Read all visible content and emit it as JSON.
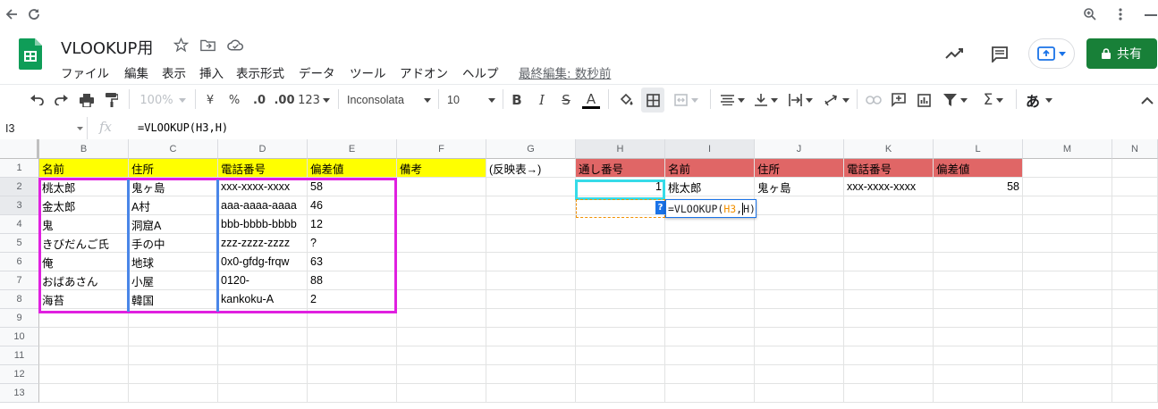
{
  "doc": {
    "title": "VLOOKUP用",
    "last_edit": "最終編集: 数秒前",
    "share_label": "共有"
  },
  "menu": [
    "ファイル",
    "編集",
    "表示",
    "挿入",
    "表示形式",
    "データ",
    "ツール",
    "アドオン",
    "ヘルプ"
  ],
  "toolbar": {
    "zoom": "100%",
    "currency": "¥",
    "percent": "%",
    "dec_less": ".0",
    "dec_more": ".00",
    "format_more": "123",
    "font": "Inconsolata",
    "font_size": "10",
    "input_tool": "あ"
  },
  "formula_bar": {
    "cell_ref": "I3",
    "fx": "fx",
    "formula": "=VLOOKUP(H3,H)"
  },
  "columns": [
    "B",
    "C",
    "D",
    "E",
    "F",
    "G",
    "H",
    "I",
    "J",
    "K",
    "L",
    "M",
    "N"
  ],
  "rows": [
    "1",
    "2",
    "3",
    "4",
    "5",
    "6",
    "7",
    "8",
    "9",
    "10",
    "11",
    "12",
    "13"
  ],
  "cells": {
    "B1": "名前",
    "C1": "住所",
    "D1": "電話番号",
    "E1": "偏差値",
    "F1": "備考",
    "G1": "(反映表→)",
    "H1": "通し番号",
    "I1": "名前",
    "J1": "住所",
    "K1": "電話番号",
    "L1": "偏差値",
    "B2": "桃太郎",
    "C2": "鬼ヶ島",
    "D2": "xxx-xxxx-xxxx",
    "E2": "58",
    "B3": "金太郎",
    "C3": "A村",
    "D3": "aaa-aaaa-aaaa",
    "E3": "46",
    "B4": "鬼",
    "C4": "洞窟A",
    "D4": "bbb-bbbb-bbbb",
    "E4": "12",
    "B5": "きびだんご氏",
    "C5": "手の中",
    "D5": "zzz-zzzz-zzzz",
    "E5": "?",
    "B6": "俺",
    "C6": "地球",
    "D6": "0x0-gfdg-frqw",
    "E6": "63",
    "B7": "おばあさん",
    "C7": "小屋",
    "D7": "0120-",
    "E7": "88",
    "B8": "海苔",
    "C8": "韓国",
    "D8": "kankoku-A",
    "E8": "2",
    "H2": "1",
    "I2": "桃太郎",
    "J2": "鬼ヶ島",
    "K2": "xxx-xxxx-xxxx",
    "L2": "58"
  },
  "editor": {
    "prefix": "=VLOOKUP(",
    "ref": "H3",
    "comma": ",",
    "arg": "H",
    "close": ")",
    "help": "?"
  },
  "colors": {
    "yellow_header": "#ffff00",
    "red_header": "#e06666",
    "magenta_border": "#e020e0",
    "blue_border": "#4a86e8",
    "cyan_selection": "#36dbe8",
    "share_green": "#188038",
    "ref_orange": "#f29000"
  }
}
